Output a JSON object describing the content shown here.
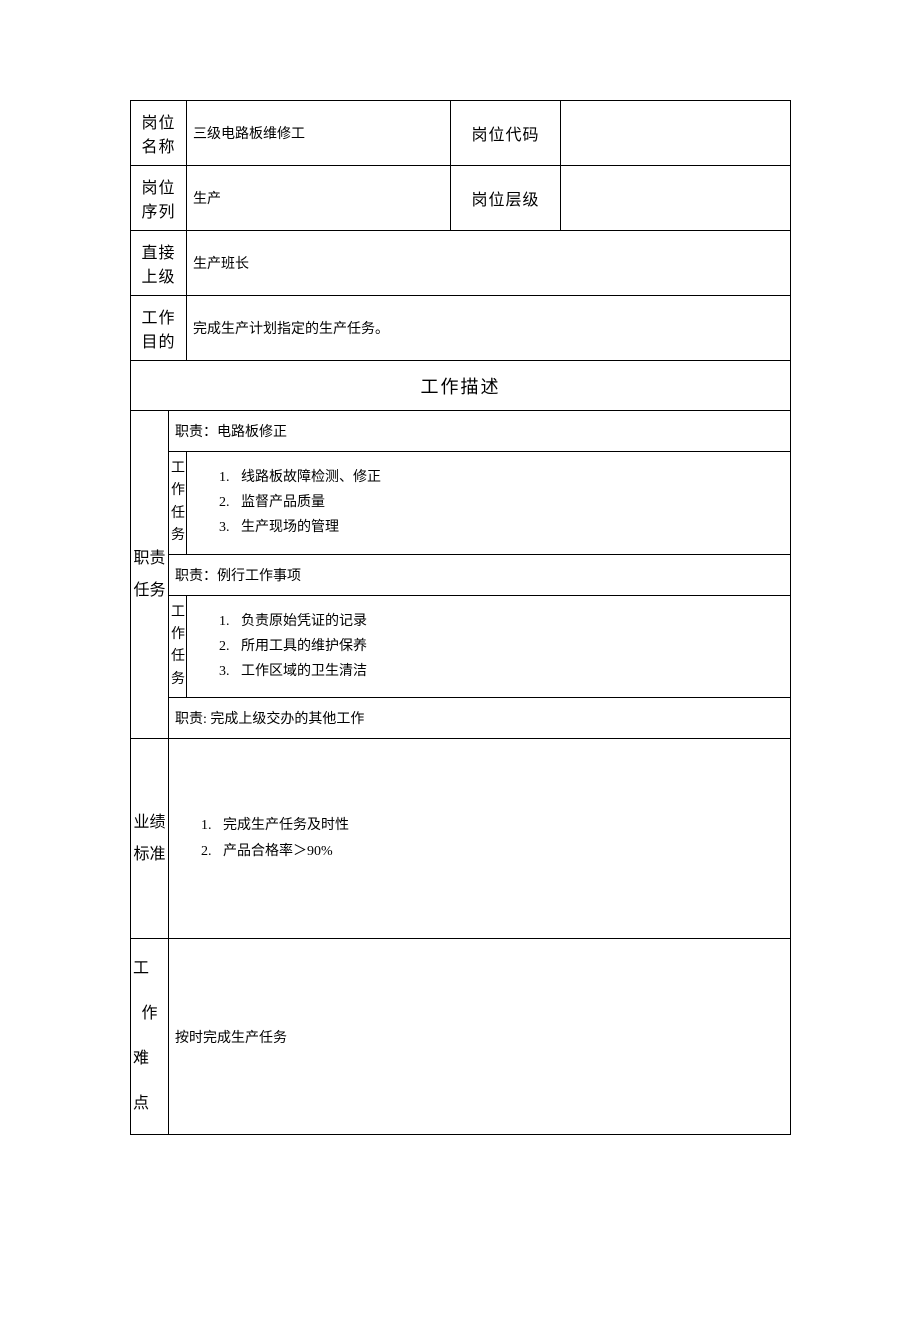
{
  "header": {
    "positionNameLabel": "岗位名称",
    "positionNameValue": "三级电路板维修工",
    "positionCodeLabel": "岗位代码",
    "positionCodeValue": "",
    "positionSeriesLabel": "岗位序列",
    "positionSeriesValue": "生产",
    "positionLevelLabel": "岗位层级",
    "positionLevelValue": "",
    "directSupervisorLabel": "直接上级",
    "directSupervisorValue": "生产班长",
    "workPurposeLabel": "工作目的",
    "workPurposeValue": "完成生产计划指定的生产任务。"
  },
  "descHeader": "工作描述",
  "dutiesTasks": {
    "sideLabel": "职责\n任务",
    "duty1": "职责：电路板修正",
    "taskLabel": "工作任务",
    "tasks1": [
      "线路板故障检测、修正",
      "监督产品质量",
      "生产现场的管理"
    ],
    "duty2": "职责：例行工作事项",
    "tasks2": [
      "负责原始凭证的记录",
      "所用工具的维护保养",
      "工作区域的卫生清洁"
    ],
    "duty3": "职责: 完成上级交办的其他工作"
  },
  "performance": {
    "sideLabel": "业绩\n标准",
    "items": [
      "完成生产任务及时性",
      "产品合格率＞90%"
    ]
  },
  "difficulty": {
    "sideLabel": "工\n作\n难\n点",
    "value": "按时完成生产任务"
  }
}
